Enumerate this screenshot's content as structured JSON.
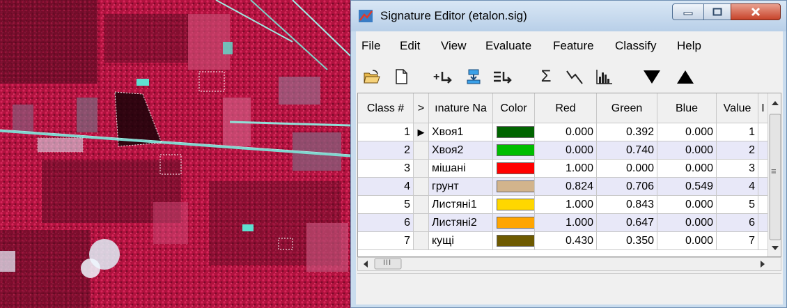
{
  "window": {
    "title": "Signature Editor (etalon.sig)"
  },
  "menu": [
    "File",
    "Edit",
    "View",
    "Evaluate",
    "Feature",
    "Classify",
    "Help"
  ],
  "toolbar": {
    "icons": [
      "open-folder-icon",
      "new-document-icon",
      "add-signature-icon",
      "replace-signature-icon",
      "merge-signatures-icon",
      "statistics-icon",
      "mean-plot-icon",
      "histogram-icon",
      "move-down-icon",
      "move-up-icon"
    ],
    "sigma_glyph": "Σ"
  },
  "table": {
    "columns": [
      "Class #",
      ">",
      "ınature Na",
      "Color",
      "Red",
      "Green",
      "Blue",
      "Value",
      "I"
    ],
    "rows": [
      {
        "class": "1",
        "current": "▶",
        "name": "Хвоя1",
        "color": "#006400",
        "red": "0.000",
        "green": "0.392",
        "blue": "0.000",
        "value": "1"
      },
      {
        "class": "2",
        "current": "",
        "name": "Хвоя2",
        "color": "#00bd00",
        "red": "0.000",
        "green": "0.740",
        "blue": "0.000",
        "value": "2"
      },
      {
        "class": "3",
        "current": "",
        "name": "мішані",
        "color": "#ff0000",
        "red": "1.000",
        "green": "0.000",
        "blue": "0.000",
        "value": "3"
      },
      {
        "class": "4",
        "current": "",
        "name": "грунт",
        "color": "#d2b48c",
        "red": "0.824",
        "green": "0.706",
        "blue": "0.549",
        "value": "4"
      },
      {
        "class": "5",
        "current": "",
        "name": "Листяні1",
        "color": "#ffd700",
        "red": "1.000",
        "green": "0.843",
        "blue": "0.000",
        "value": "5"
      },
      {
        "class": "6",
        "current": "",
        "name": "Листяні2",
        "color": "#ffa500",
        "red": "1.000",
        "green": "0.647",
        "blue": "0.000",
        "value": "6"
      },
      {
        "class": "7",
        "current": "",
        "name": "кущі",
        "color": "#6e5a00",
        "red": "0.430",
        "green": "0.350",
        "blue": "0.000",
        "value": "7"
      }
    ]
  },
  "scrollbar": {
    "thumb_glyph": "III",
    "vthumb_glyph": "≡"
  }
}
